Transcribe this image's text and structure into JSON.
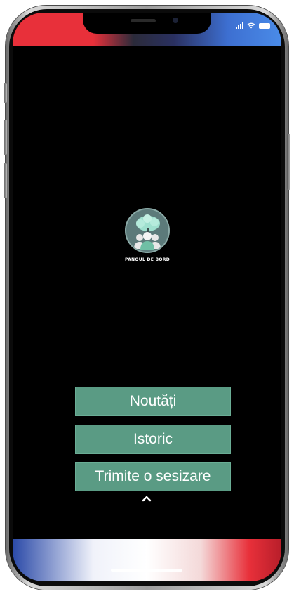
{
  "device": {
    "model": "phone-frame"
  },
  "status_bar": {
    "icons": [
      "signal-icon",
      "wifi-icon",
      "battery-icon"
    ]
  },
  "app": {
    "logo": {
      "icon": "people-tree-logo",
      "caption": "PANOUL DE BORD"
    },
    "buttons": {
      "news_label": "Noutăți",
      "history_label": "Istoric",
      "report_label": "Trimite o sesizare"
    },
    "expand_icon": "chevron-up-icon"
  },
  "colors": {
    "button_bg": "#5a9b84",
    "screen_bg": "#000000",
    "logo_bg": "#5c7a7a"
  }
}
